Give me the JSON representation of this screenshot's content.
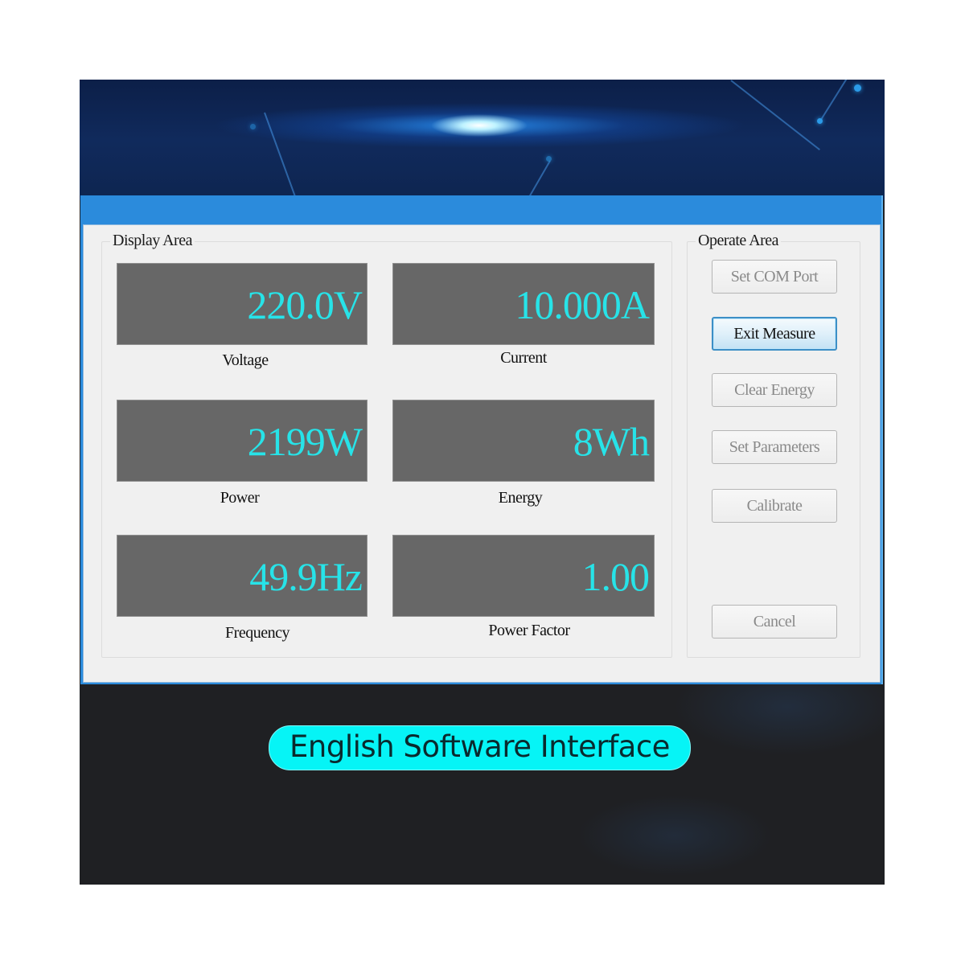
{
  "colors": {
    "readout_text": "#27e3e8",
    "readout_bg": "#676767",
    "titlebar": "#2b8bdc",
    "caption_pill": "#06f4f6"
  },
  "window": {
    "title": ""
  },
  "display_area": {
    "title": "Display Area",
    "readouts": [
      {
        "label": "Voltage",
        "value": "220.0V"
      },
      {
        "label": "Current",
        "value": "10.000A"
      },
      {
        "label": "Power",
        "value": "2199W"
      },
      {
        "label": "Energy",
        "value": "8Wh"
      },
      {
        "label": "Frequency",
        "value": "49.9Hz"
      },
      {
        "label": "Power Factor",
        "value": "1.00"
      }
    ]
  },
  "operate_area": {
    "title": "Operate Area",
    "buttons": [
      {
        "label": "Set COM Port",
        "state": "disabled"
      },
      {
        "label": "Exit Measure",
        "state": "focused"
      },
      {
        "label": "Clear Energy",
        "state": "disabled"
      },
      {
        "label": "Set Parameters",
        "state": "disabled"
      },
      {
        "label": "Calibrate",
        "state": "disabled"
      },
      {
        "label": "Cancel",
        "state": "disabled"
      }
    ]
  },
  "caption": "English Software Interface"
}
